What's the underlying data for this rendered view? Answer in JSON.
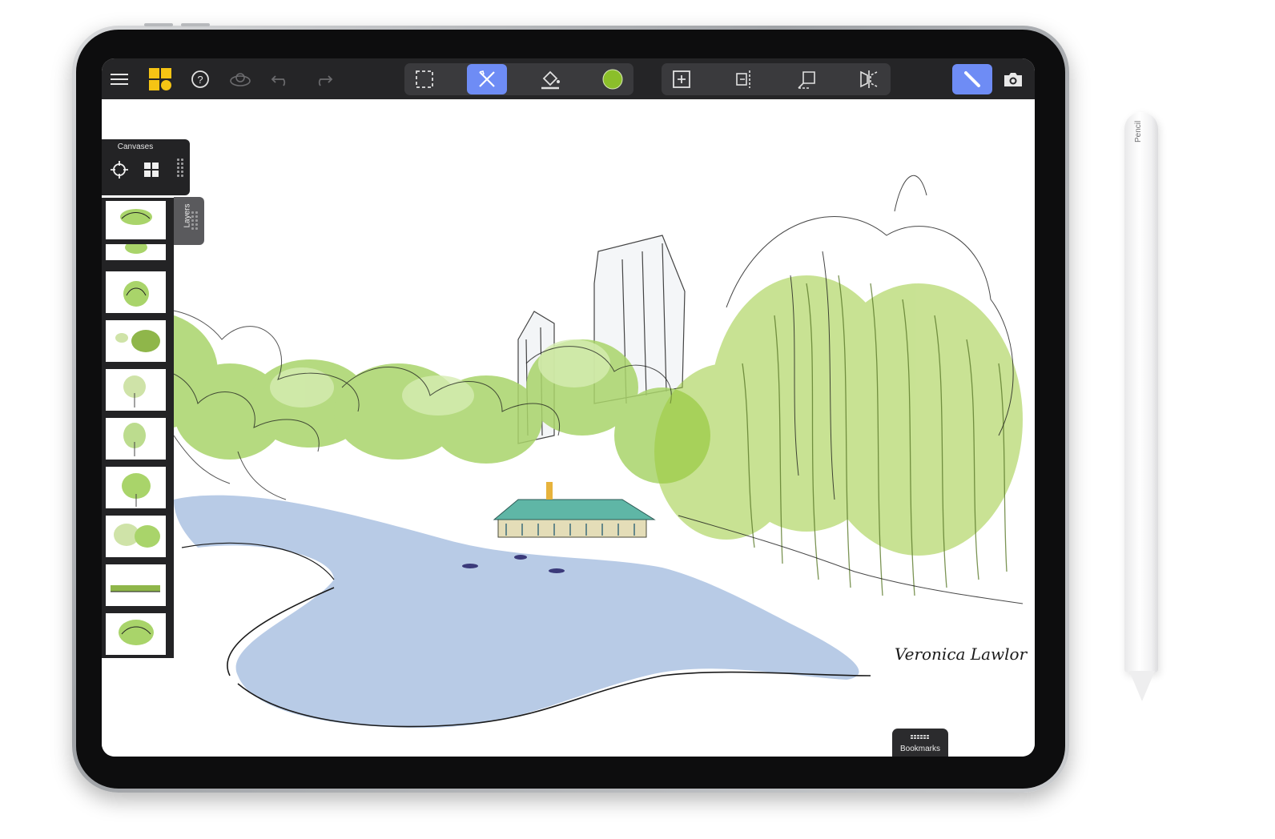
{
  "toolbar": {
    "left_icons": [
      "menu-icon",
      "app-grid-icon",
      "help-icon",
      "stabilizer-icon",
      "undo-icon",
      "redo-icon"
    ],
    "group1": [
      "selection-icon",
      "freehand-tools-icon",
      "fill-bucket-icon",
      "color-swatch"
    ],
    "group2": [
      "add-canvas-icon",
      "ruler-icon",
      "perspective-icon",
      "symmetry-icon"
    ],
    "right_icons": [
      "pencil-mode-icon",
      "camera-icon"
    ],
    "color_swatch": "#8bbf2a",
    "active_color": "#6e8cf5",
    "brand_yellow": "#f5c414"
  },
  "canvases_panel": {
    "title": "Canvases",
    "icons": [
      "target-icon",
      "grid-view-icon"
    ]
  },
  "layers_tab": {
    "label": "Layers"
  },
  "bookmarks": {
    "label": "Bookmarks"
  },
  "pencil": {
    "label": "Pencil"
  },
  "signature": "Veronica Lawlor",
  "colors": {
    "water": "#b8cbe6",
    "foliage_green": "#8fc23a",
    "dark_green": "#5b7a2a",
    "ink": "#1a1a1a"
  }
}
